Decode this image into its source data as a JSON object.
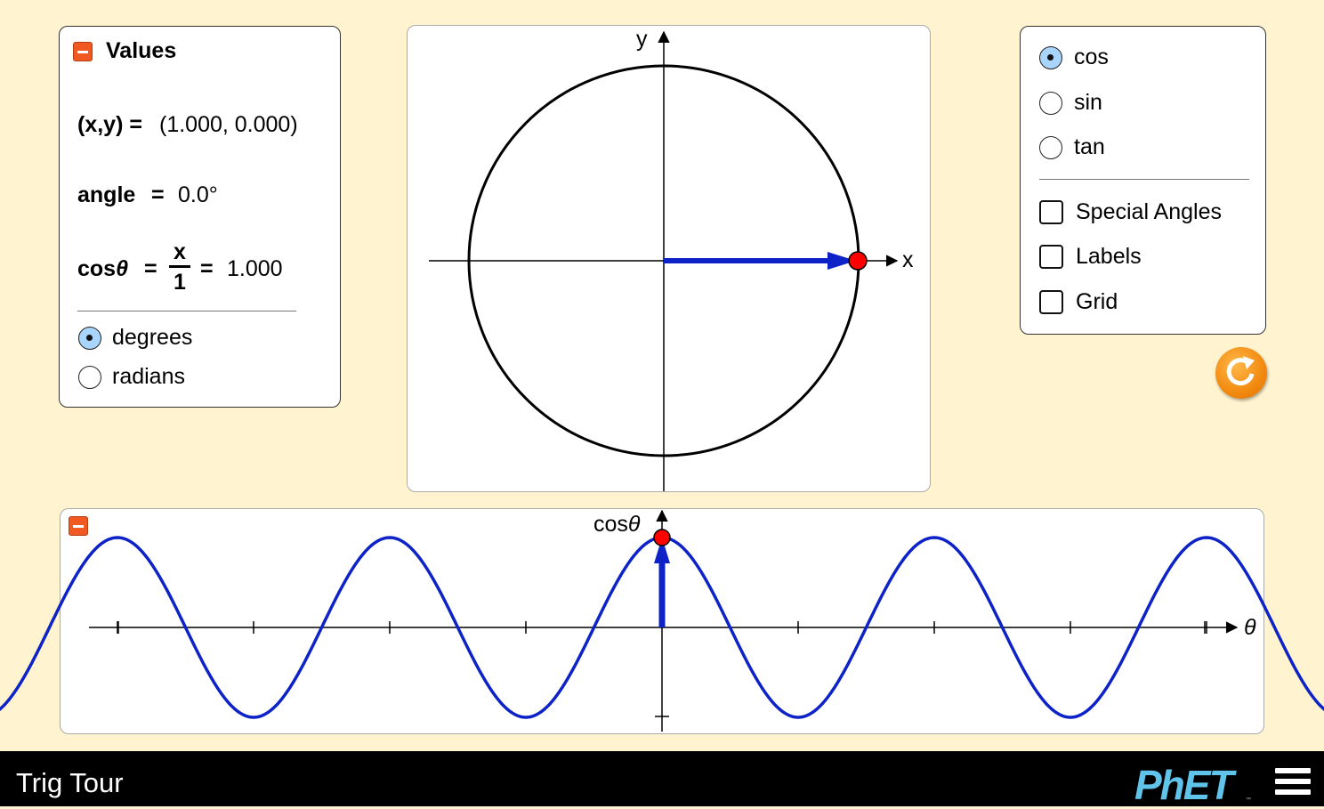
{
  "values_panel": {
    "title": "Values",
    "xy_label": "(x,y) =",
    "xy_value": "(1.000, 0.000)",
    "angle_label": "angle",
    "angle_eq": "=",
    "angle_value": "0.0°",
    "trig_label": "cos",
    "trig_theta": "θ",
    "trig_eq": "=",
    "fraction_numerator": "x",
    "fraction_denominator": "1",
    "fraction_eq": "=",
    "trig_value": "1.000",
    "units": [
      {
        "label": "degrees",
        "selected": true
      },
      {
        "label": "radians",
        "selected": false
      }
    ]
  },
  "unit_circle": {
    "x_axis_label": "x",
    "y_axis_label": "y",
    "point": {
      "x": 1.0,
      "y": 0.0
    },
    "angle_deg": 0.0
  },
  "controls_panel": {
    "functions": [
      {
        "label": "cos",
        "selected": true
      },
      {
        "label": "sin",
        "selected": false
      },
      {
        "label": "tan",
        "selected": false
      }
    ],
    "checkboxes": [
      {
        "label": "Special Angles",
        "checked": false
      },
      {
        "label": "Labels",
        "checked": false
      },
      {
        "label": "Grid",
        "checked": false
      }
    ]
  },
  "graph_panel": {
    "y_axis_label": "cos",
    "y_axis_theta": "θ",
    "x_axis_label": "θ",
    "function": "cos",
    "current_theta": 0.0,
    "current_value": 1.0,
    "periods_each_side": 2
  },
  "colors": {
    "background": "#fff4cf",
    "curve": "#0d23c8",
    "point": "#ff0000",
    "accent": "#f05a22",
    "phet_logo": "#5fc3ea"
  },
  "navbar": {
    "title": "Trig Tour",
    "logo_text": "PhET",
    "trademark": "™",
    "menu_icon": "hamburger-menu-icon"
  }
}
